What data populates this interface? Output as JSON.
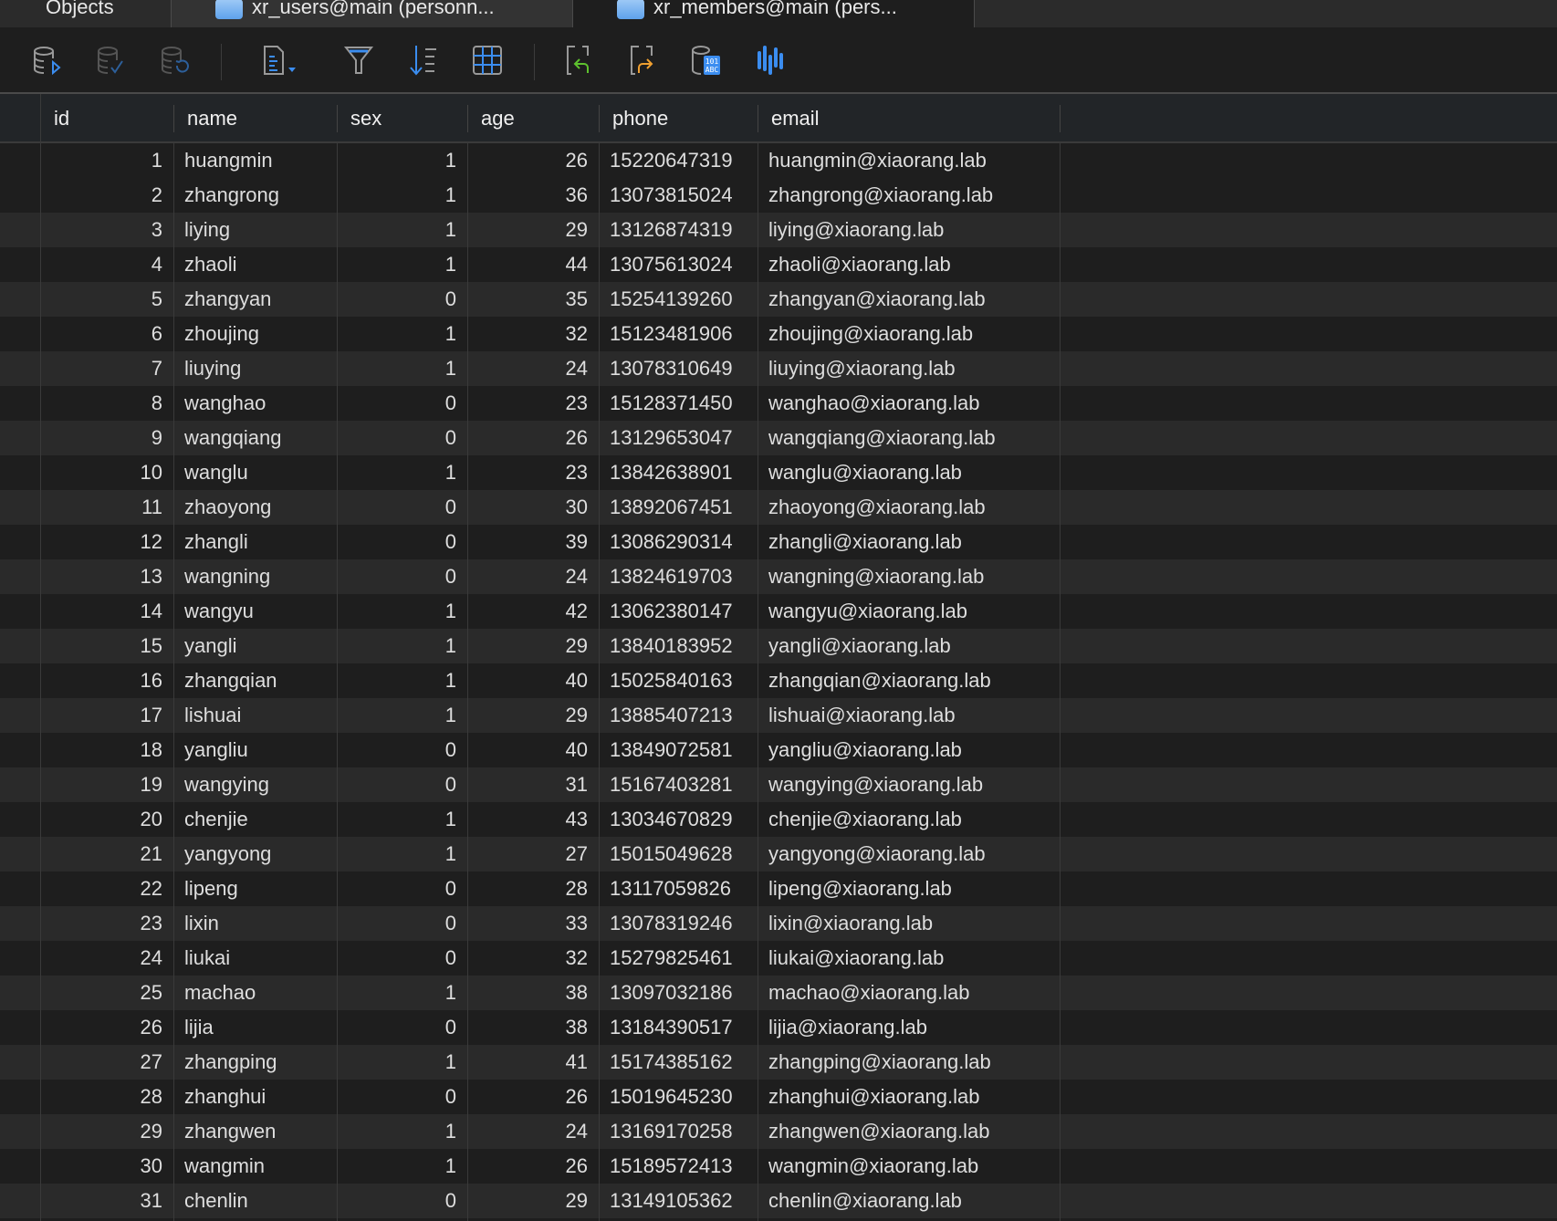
{
  "tabs": [
    {
      "label": "Objects"
    },
    {
      "label": "xr_users@main (personn..."
    },
    {
      "label": "xr_members@main (pers..."
    }
  ],
  "toolbar": {
    "icons": [
      "begin-transaction-icon",
      "commit-icon",
      "rollback-icon",
      "text-export-icon",
      "filter-icon",
      "sort-icon",
      "grid-view-icon",
      "import-icon",
      "export-icon",
      "data-generation-icon",
      "chart-icon"
    ]
  },
  "columns": [
    "id",
    "name",
    "sex",
    "age",
    "phone",
    "email"
  ],
  "rows": [
    [
      "1",
      "huangmin",
      "1",
      "26",
      "15220647319",
      "huangmin@xiaorang.lab"
    ],
    [
      "2",
      "zhangrong",
      "1",
      "36",
      "13073815024",
      "zhangrong@xiaorang.lab"
    ],
    [
      "3",
      "liying",
      "1",
      "29",
      "13126874319",
      "liying@xiaorang.lab"
    ],
    [
      "4",
      "zhaoli",
      "1",
      "44",
      "13075613024",
      "zhaoli@xiaorang.lab"
    ],
    [
      "5",
      "zhangyan",
      "0",
      "35",
      "15254139260",
      "zhangyan@xiaorang.lab"
    ],
    [
      "6",
      "zhoujing",
      "1",
      "32",
      "15123481906",
      "zhoujing@xiaorang.lab"
    ],
    [
      "7",
      "liuying",
      "1",
      "24",
      "13078310649",
      "liuying@xiaorang.lab"
    ],
    [
      "8",
      "wanghao",
      "0",
      "23",
      "15128371450",
      "wanghao@xiaorang.lab"
    ],
    [
      "9",
      "wangqiang",
      "0",
      "26",
      "13129653047",
      "wangqiang@xiaorang.lab"
    ],
    [
      "10",
      "wanglu",
      "1",
      "23",
      "13842638901",
      "wanglu@xiaorang.lab"
    ],
    [
      "11",
      "zhaoyong",
      "0",
      "30",
      "13892067451",
      "zhaoyong@xiaorang.lab"
    ],
    [
      "12",
      "zhangli",
      "0",
      "39",
      "13086290314",
      "zhangli@xiaorang.lab"
    ],
    [
      "13",
      "wangning",
      "0",
      "24",
      "13824619703",
      "wangning@xiaorang.lab"
    ],
    [
      "14",
      "wangyu",
      "1",
      "42",
      "13062380147",
      "wangyu@xiaorang.lab"
    ],
    [
      "15",
      "yangli",
      "1",
      "29",
      "13840183952",
      "yangli@xiaorang.lab"
    ],
    [
      "16",
      "zhangqian",
      "1",
      "40",
      "15025840163",
      "zhangqian@xiaorang.lab"
    ],
    [
      "17",
      "lishuai",
      "1",
      "29",
      "13885407213",
      "lishuai@xiaorang.lab"
    ],
    [
      "18",
      "yangliu",
      "0",
      "40",
      "13849072581",
      "yangliu@xiaorang.lab"
    ],
    [
      "19",
      "wangying",
      "0",
      "31",
      "15167403281",
      "wangying@xiaorang.lab"
    ],
    [
      "20",
      "chenjie",
      "1",
      "43",
      "13034670829",
      "chenjie@xiaorang.lab"
    ],
    [
      "21",
      "yangyong",
      "1",
      "27",
      "15015049628",
      "yangyong@xiaorang.lab"
    ],
    [
      "22",
      "lipeng",
      "0",
      "28",
      "13117059826",
      "lipeng@xiaorang.lab"
    ],
    [
      "23",
      "lixin",
      "0",
      "33",
      "13078319246",
      "lixin@xiaorang.lab"
    ],
    [
      "24",
      "liukai",
      "0",
      "32",
      "15279825461",
      "liukai@xiaorang.lab"
    ],
    [
      "25",
      "machao",
      "1",
      "38",
      "13097032186",
      "machao@xiaorang.lab"
    ],
    [
      "26",
      "lijia",
      "0",
      "38",
      "13184390517",
      "lijia@xiaorang.lab"
    ],
    [
      "27",
      "zhangping",
      "1",
      "41",
      "15174385162",
      "zhangping@xiaorang.lab"
    ],
    [
      "28",
      "zhanghui",
      "0",
      "26",
      "15019645230",
      "zhanghui@xiaorang.lab"
    ],
    [
      "29",
      "zhangwen",
      "1",
      "24",
      "13169170258",
      "zhangwen@xiaorang.lab"
    ],
    [
      "30",
      "wangmin",
      "1",
      "26",
      "15189572413",
      "wangmin@xiaorang.lab"
    ],
    [
      "31",
      "chenlin",
      "0",
      "29",
      "13149105362",
      "chenlin@xiaorang.lab"
    ]
  ]
}
